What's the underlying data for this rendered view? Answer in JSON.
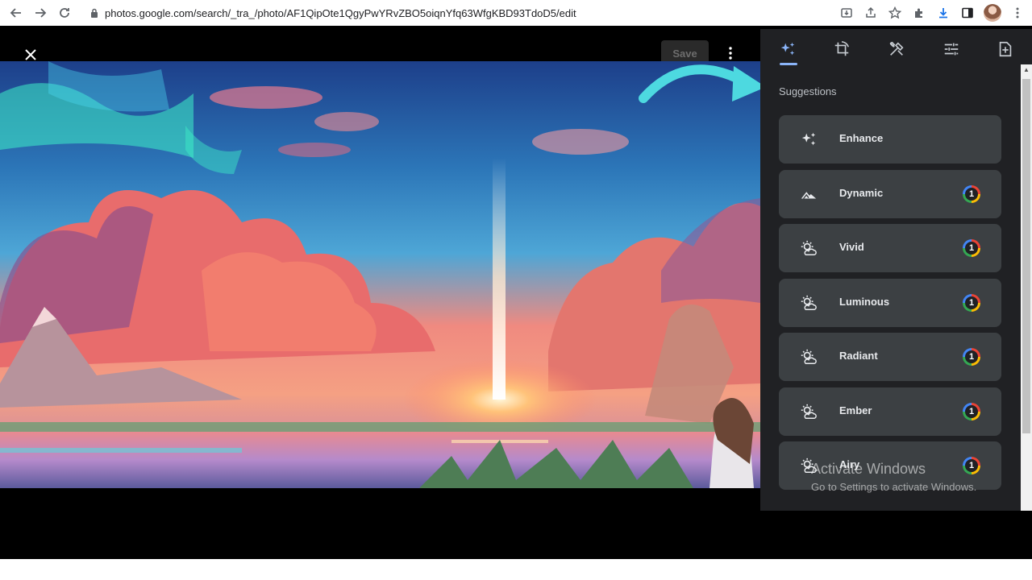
{
  "browser": {
    "url": "photos.google.com/search/_tra_/photo/AF1QipOte1QgyPwYRvZBO5oiqnYfq63WfgKBD93TdoD5/edit",
    "icons": [
      "back-icon",
      "forward-icon",
      "reload-icon",
      "lock-icon",
      "install-icon",
      "share-icon",
      "bookmark-star-icon",
      "extensions-icon",
      "download-icon",
      "side-panel-icon",
      "profile-avatar",
      "menu-icon"
    ]
  },
  "viewer": {
    "save_label": "Save",
    "close_icon": "close-icon",
    "more_icon": "more-vert-icon"
  },
  "panel": {
    "tabs": [
      {
        "name": "suggestions-tab",
        "icon": "sparkle-icon",
        "active": true
      },
      {
        "name": "crop-tab",
        "icon": "crop-rotate-icon",
        "active": false
      },
      {
        "name": "tools-tab",
        "icon": "tools-icon",
        "active": false
      },
      {
        "name": "adjust-tab",
        "icon": "sliders-icon",
        "active": false
      },
      {
        "name": "export-tab",
        "icon": "export-icon",
        "active": false
      }
    ],
    "section_title": "Suggestions",
    "items": [
      {
        "label": "Enhance",
        "icon": "sparkle-icon",
        "badge": ""
      },
      {
        "label": "Dynamic",
        "icon": "mountain-icon",
        "badge": "1"
      },
      {
        "label": "Vivid",
        "icon": "sun-cloud-icon",
        "badge": "1"
      },
      {
        "label": "Luminous",
        "icon": "sun-cloud-icon",
        "badge": "1"
      },
      {
        "label": "Radiant",
        "icon": "sun-cloud-icon",
        "badge": "1"
      },
      {
        "label": "Ember",
        "icon": "sun-cloud-icon",
        "badge": "1"
      },
      {
        "label": "Airy",
        "icon": "sun-cloud-icon",
        "badge": "1"
      }
    ]
  },
  "watermark": {
    "line1": "Activate Windows",
    "line2": "Go to Settings to activate Windows."
  },
  "colors": {
    "accent": "#8ab4f8",
    "panel_bg": "#202124",
    "card_bg": "#3c4043",
    "annotation_arrow": "#4dd9e0"
  }
}
